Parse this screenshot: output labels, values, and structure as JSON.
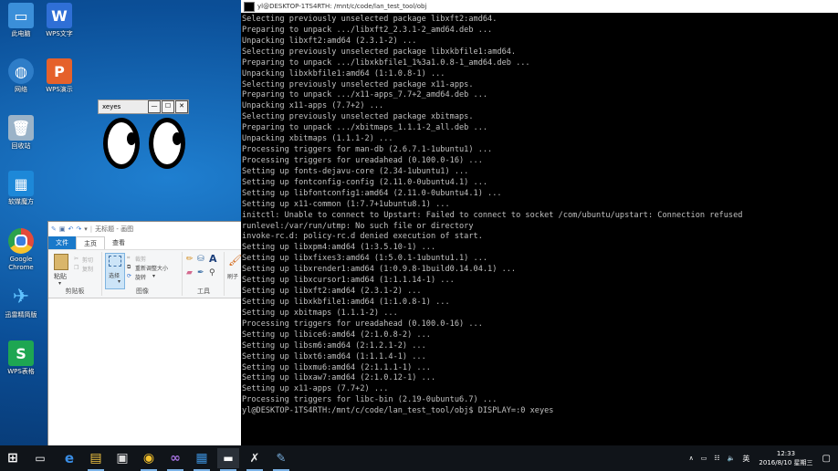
{
  "desktop": {
    "icons": [
      {
        "label": "此电脑",
        "icon": "computer-icon",
        "color": "#3b8fd9"
      },
      {
        "label": "WPS文字",
        "icon": "wps-writer-icon",
        "color": "#2f6fd6"
      },
      {
        "label": "网络",
        "icon": "network-icon",
        "color": "#2e7dc8"
      },
      {
        "label": "WPS演示",
        "icon": "wps-presentation-icon",
        "color": "#e5612b"
      },
      {
        "label": "回收站",
        "icon": "recycle-bin-icon",
        "color": "#9bb3c8"
      },
      {
        "label": "软媒魔方",
        "icon": "ruanmei-cube-icon",
        "color": "#1d88d8"
      },
      {
        "label": "Google Chrome",
        "icon": "chrome-icon",
        "color": "#e24a3b"
      },
      {
        "label": "迅雷精简版",
        "icon": "xunlei-icon",
        "color": "#1c73c9"
      },
      {
        "label": "WPS表格",
        "icon": "wps-spreadsheet-icon",
        "color": "#1ea652"
      }
    ]
  },
  "xeyes": {
    "title": "xeyes",
    "min": "—",
    "max": "☐",
    "close": "✕"
  },
  "paint": {
    "title": "无标题 - 画图",
    "tabs": [
      "文件",
      "主页",
      "查看"
    ],
    "clipboard": {
      "paste": "粘贴",
      "cut": "剪切",
      "copy": "复制",
      "label": "剪贴板"
    },
    "image": {
      "select": "选择",
      "crop": "裁剪",
      "resize": "重新调整大小",
      "rotate": "旋转",
      "label": "图像"
    },
    "tools": {
      "label": "工具"
    },
    "brush": "刷子"
  },
  "terminal": {
    "title": "yl@DESKTOP-1TS4RTH: /mnt/c/code/lan_test_tool/obj",
    "lines": [
      "Selecting previously unselected package libxft2:amd64.",
      "Preparing to unpack .../libxft2_2.3.1-2_amd64.deb ...",
      "Unpacking libxft2:amd64 (2.3.1-2) ...",
      "Selecting previously unselected package libxkbfile1:amd64.",
      "Preparing to unpack .../libxkbfile1_1%3a1.0.8-1_amd64.deb ...",
      "Unpacking libxkbfile1:amd64 (1:1.0.8-1) ...",
      "Selecting previously unselected package x11-apps.",
      "Preparing to unpack .../x11-apps_7.7+2_amd64.deb ...",
      "Unpacking x11-apps (7.7+2) ...",
      "Selecting previously unselected package xbitmaps.",
      "Preparing to unpack .../xbitmaps_1.1.1-2_all.deb ...",
      "Unpacking xbitmaps (1.1.1-2) ...",
      "Processing triggers for man-db (2.6.7.1-1ubuntu1) ...",
      "Processing triggers for ureadahead (0.100.0-16) ...",
      "Setting up fonts-dejavu-core (2.34-1ubuntu1) ...",
      "Setting up fontconfig-config (2.11.0-0ubuntu4.1) ...",
      "Setting up libfontconfig1:amd64 (2.11.0-0ubuntu4.1) ...",
      "Setting up x11-common (1:7.7+1ubuntu8.1) ...",
      "initctl: Unable to connect to Upstart: Failed to connect to socket /com/ubuntu/upstart: Connection refused",
      "runlevel:/var/run/utmp: No such file or directory",
      "invoke-rc.d: policy-rc.d denied execution of start.",
      "Setting up libxpm4:amd64 (1:3.5.10-1) ...",
      "Setting up libxfixes3:amd64 (1:5.0.1-1ubuntu1.1) ...",
      "Setting up libxrender1:amd64 (1:0.9.8-1build0.14.04.1) ...",
      "Setting up libxcursor1:amd64 (1:1.1.14-1) ...",
      "Setting up libxft2:amd64 (2.3.1-2) ...",
      "Setting up libxkbfile1:amd64 (1:1.0.8-1) ...",
      "Setting up xbitmaps (1.1.1-2) ...",
      "Processing triggers for ureadahead (0.100.0-16) ...",
      "Setting up libice6:amd64 (2:1.0.8-2) ...",
      "Setting up libsm6:amd64 (2:1.2.1-2) ...",
      "Setting up libxt6:amd64 (1:1.1.4-1) ...",
      "Setting up libxmu6:amd64 (2:1.1.1-1) ...",
      "Setting up libxaw7:amd64 (2:1.0.12-1) ...",
      "Setting up x11-apps (7.7+2) ...",
      "Processing triggers for libc-bin (2.19-0ubuntu6.7) ...",
      "yl@DESKTOP-1TS4RTH:/mnt/c/code/lan_test_tool/obj$ DISPLAY=:0 xeyes"
    ]
  },
  "taskbar": {
    "items": [
      {
        "icon": "windows-start-icon",
        "glyph": "⊞"
      },
      {
        "icon": "task-view-icon",
        "glyph": "▭"
      },
      {
        "icon": "edge-icon",
        "glyph": "e"
      },
      {
        "icon": "file-explorer-icon",
        "glyph": "▤"
      },
      {
        "icon": "store-icon",
        "glyph": "▣"
      },
      {
        "icon": "chrome-icon",
        "glyph": "◉"
      },
      {
        "icon": "visual-studio-icon",
        "glyph": "∞"
      },
      {
        "icon": "app-window-icon",
        "glyph": "▦"
      },
      {
        "icon": "terminal-icon",
        "glyph": "▬"
      },
      {
        "icon": "xeyes-app-icon",
        "glyph": "✗"
      },
      {
        "icon": "paint-icon",
        "glyph": "✎"
      }
    ],
    "tray": {
      "chevron": "∧",
      "battery": "▭",
      "network": "☷",
      "volume": "🔈",
      "ime": "英"
    },
    "time": "12:33",
    "date": "2016/8/10 星期三",
    "notification": "▢"
  }
}
